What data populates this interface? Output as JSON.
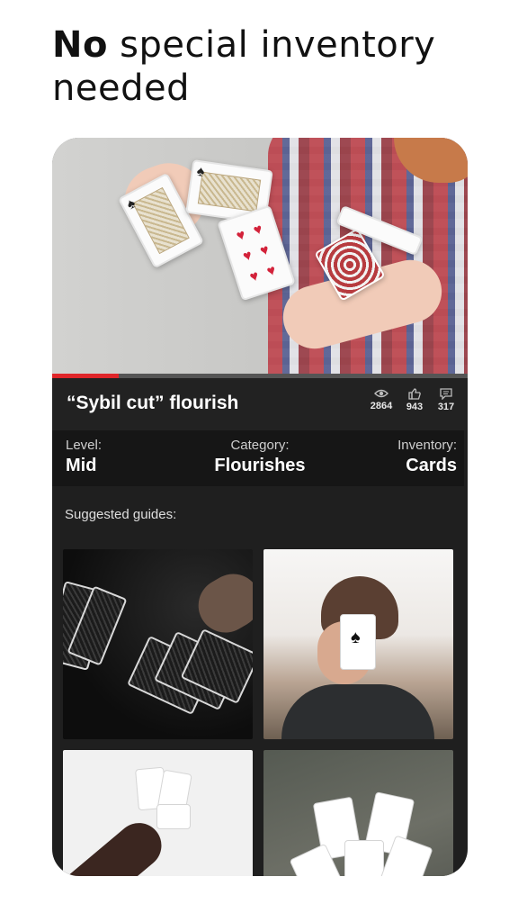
{
  "headline": {
    "bold": "No",
    "rest": " special inventory needed"
  },
  "video": {
    "title": "“Sybil cut” flourish",
    "progress_percent": 16,
    "stats": [
      {
        "icon": "eye-icon",
        "value": "2864"
      },
      {
        "icon": "thumbs-up-icon",
        "value": "943"
      },
      {
        "icon": "comment-icon",
        "value": "317"
      }
    ]
  },
  "info": {
    "level_label": "Level:",
    "level_value": "Mid",
    "category_label": "Category:",
    "category_value": "Flourishes",
    "inventory_label": "Inventory:",
    "inventory_value": "Cards"
  },
  "suggested": {
    "label": "Suggested guides:"
  },
  "colors": {
    "accent": "#e0262a",
    "panel": "#1f1f1f",
    "bar": "#161616"
  }
}
